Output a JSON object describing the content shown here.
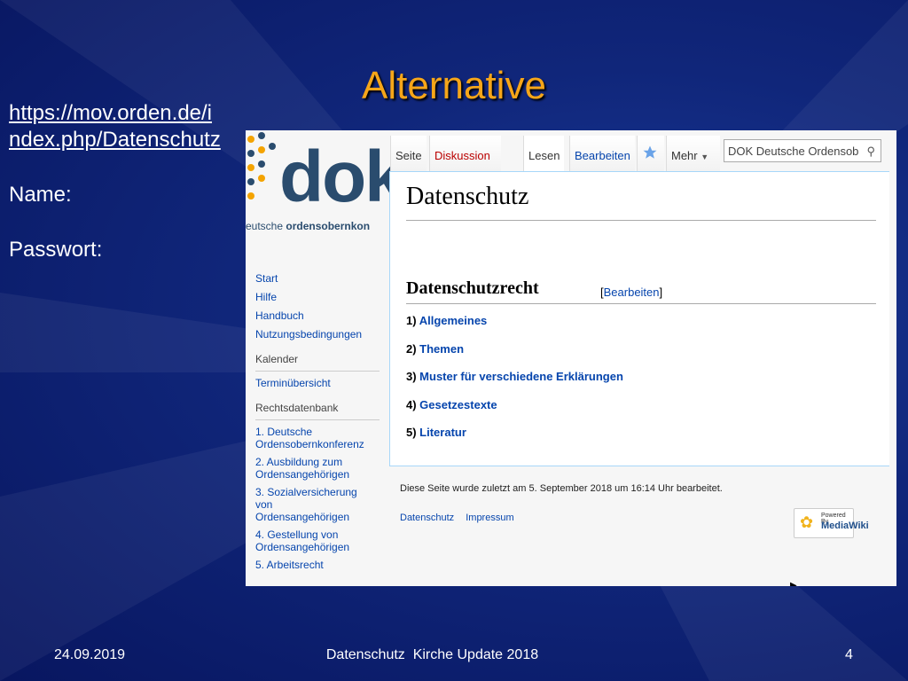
{
  "slide": {
    "title": "Alternative",
    "url_line1": "https://mov.orden.de/i",
    "url_line2": "ndex.php/Datenschutz",
    "name_label": "Name:",
    "password_label": "Passwort:",
    "footer_date": "24.09.2019",
    "footer_center": "Datenschutz  Kirche Update 2018",
    "footer_page": "4"
  },
  "wiki": {
    "logo_text": "dok",
    "logo_sub_1": "eutsche ",
    "logo_sub_2": "ordensobernkon",
    "tabs": {
      "seite": "Seite",
      "diskussion": "Diskussion",
      "lesen": "Lesen",
      "bearbeiten": "Bearbeiten",
      "mehr": "Mehr"
    },
    "search_placeholder": "DOK Deutsche Ordensob",
    "page_title": "Datenschutz",
    "section_title": "Datenschutzrecht",
    "section_edit": "Bearbeiten",
    "items": [
      {
        "num": "1) ",
        "label": "Allgemeines"
      },
      {
        "num": "2) ",
        "label": "Themen"
      },
      {
        "num": "3) ",
        "label": "Muster für verschiedene Erklärungen"
      },
      {
        "num": "4) ",
        "label": "Gesetzestexte"
      },
      {
        "num": "5) ",
        "label": "Literatur"
      }
    ],
    "last_modified": "Diese Seite wurde zuletzt am 5. September 2018 um 16:14 Uhr bearbeitet.",
    "footer_links": [
      "Datenschutz",
      "Impressum"
    ],
    "badge_powered": "Powered By",
    "badge_name": "MediaWiki",
    "sidebar": {
      "start": "Start",
      "hilfe": "Hilfe",
      "handbuch": "Handbuch",
      "nutzung": "Nutzungsbedingungen",
      "kalender_head": "Kalender",
      "termine": "Terminübersicht",
      "rechts_head": "Rechtsdatenbank",
      "r1a": "1. Deutsche",
      "r1b": "Ordensobernkonferenz",
      "r2a": "2. Ausbildung zum",
      "r2b": "Ordensangehörigen",
      "r3a": "3. Sozialversicherung",
      "r3b": "von",
      "r3c": "Ordensangehörigen",
      "r4a": "4. Gestellung von",
      "r4b": "Ordensangehörigen",
      "r5a": "5. Arbeitsrecht"
    }
  }
}
